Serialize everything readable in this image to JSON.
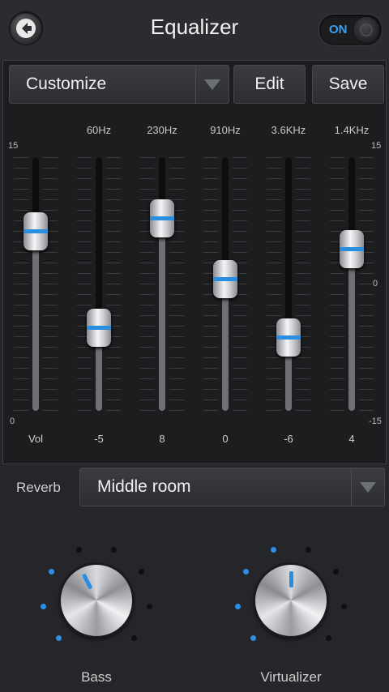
{
  "header": {
    "title": "Equalizer",
    "toggle_label": "ON"
  },
  "preset": {
    "value": "Customize",
    "edit_label": "Edit",
    "save_label": "Save"
  },
  "scale": {
    "left_top": "15",
    "left_bottom": "0",
    "right_top": "15",
    "right_mid": "0",
    "right_bottom": "-15"
  },
  "bands": [
    {
      "freq": "",
      "value": "Vol",
      "level": 0.71
    },
    {
      "freq": "60Hz",
      "value": "-5",
      "level": 0.33
    },
    {
      "freq": "230Hz",
      "value": "8",
      "level": 0.76
    },
    {
      "freq": "910Hz",
      "value": "0",
      "level": 0.52
    },
    {
      "freq": "3.6KHz",
      "value": "-6",
      "level": 0.29
    },
    {
      "freq": "1.4KHz",
      "value": "4",
      "level": 0.64
    }
  ],
  "reverb": {
    "label": "Reverb",
    "value": "Middle room"
  },
  "knobs": [
    {
      "label": "Bass",
      "level": 0.4
    },
    {
      "label": "Virtualizer",
      "level": 0.5
    }
  ],
  "colors": {
    "accent": "#2b8de0"
  }
}
